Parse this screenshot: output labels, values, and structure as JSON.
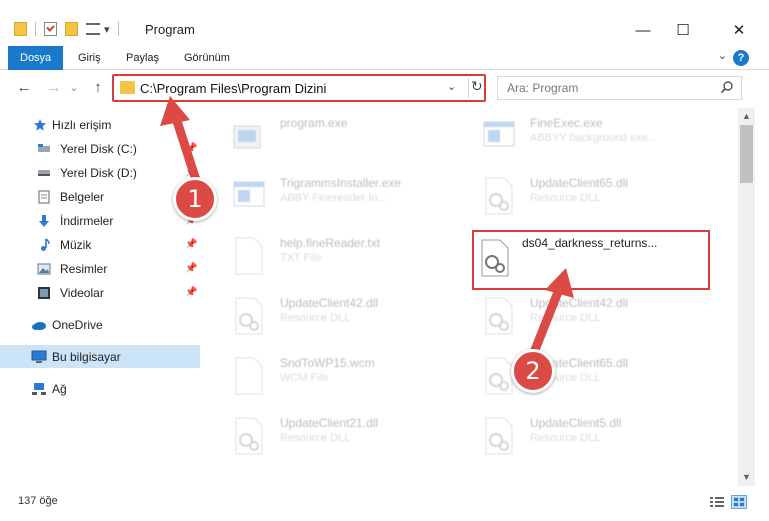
{
  "window": {
    "title": "Program",
    "minimize_glyph": "—",
    "maximize_glyph": "☐",
    "close_glyph": "✕"
  },
  "quick_access": {
    "dropdown_glyph": "▾"
  },
  "ribbon": {
    "tabs": [
      {
        "label": "Dosya",
        "active": true
      },
      {
        "label": "Giriş"
      },
      {
        "label": "Paylaş"
      },
      {
        "label": "Görünüm"
      }
    ],
    "collapse_glyph": "⌄",
    "help_label": "?"
  },
  "navigation": {
    "back_glyph": "←",
    "forward_glyph": "→",
    "recent_glyph": "⌄",
    "up_glyph": "↑",
    "address": "C:\\Program Files\\Program Dizini",
    "address_dropdown_glyph": "⌄",
    "refresh_glyph": "↻",
    "search_placeholder": "Ara: Program"
  },
  "sidebar": {
    "items": [
      {
        "label": "Hızlı erişim",
        "icon": "star-icon"
      },
      {
        "label": "Yerel Disk (C:)",
        "icon": "drive-icon",
        "pinned": true
      },
      {
        "label": "Yerel Disk (D:)",
        "icon": "drive-icon",
        "pinned": true
      },
      {
        "label": "Belgeler",
        "icon": "documents-icon",
        "pinned": true
      },
      {
        "label": "İndirmeler",
        "icon": "download-icon",
        "pinned": true
      },
      {
        "label": "Müzik",
        "icon": "music-icon",
        "pinned": true
      },
      {
        "label": "Resimler",
        "icon": "pictures-icon",
        "pinned": true
      },
      {
        "label": "Videolar",
        "icon": "videos-icon",
        "pinned": true
      },
      {
        "label": "OneDrive",
        "icon": "cloud-icon"
      },
      {
        "label": "Bu bilgisayar",
        "icon": "computer-icon",
        "selected": true
      },
      {
        "label": "Ağ",
        "icon": "network-icon"
      }
    ],
    "pin_glyph": "📌"
  },
  "files": [
    {
      "name": "program.exe",
      "sub": "",
      "icon": "exe-icon"
    },
    {
      "name": "FineExec.exe",
      "sub": "ABBYY background exe...",
      "icon": "exe-icon"
    },
    {
      "name": "TrigrammsInstaller.exe",
      "sub": "ABBY Finereader In...",
      "icon": "exe-icon"
    },
    {
      "name": "UpdateClient65.dll",
      "sub": "Resource DLL",
      "icon": "dll-icon"
    },
    {
      "name": "help.fineReader.txt",
      "sub": "TXT File",
      "icon": "txt-icon"
    },
    {
      "name": "ds04_darkness_returns...",
      "sub": "",
      "icon": "dll-icon",
      "highlight": true
    },
    {
      "name": "UpdateClient42.dll",
      "sub": "Resource DLL",
      "icon": "dll-icon"
    },
    {
      "name": "UpdateClient42.dll",
      "sub": "Resource DLL",
      "icon": "dll-icon"
    },
    {
      "name": "SndToWP15.wcm",
      "sub": "WCM File",
      "icon": "txt-icon"
    },
    {
      "name": "UpdateClient65.dll",
      "sub": "Resource DLL",
      "icon": "dll-icon"
    },
    {
      "name": "UpdateClient21.dll",
      "sub": "Resource DLL",
      "icon": "dll-icon"
    },
    {
      "name": "UpdateClient5.dll",
      "sub": "Resource DLL",
      "icon": "dll-icon"
    }
  ],
  "status": {
    "item_count": "137 öğe"
  },
  "annotations": [
    {
      "label": "1"
    },
    {
      "label": "2"
    }
  ],
  "colors": {
    "accent": "#1979ca",
    "annotation": "#db4a44",
    "selection": "#cce4f7"
  }
}
